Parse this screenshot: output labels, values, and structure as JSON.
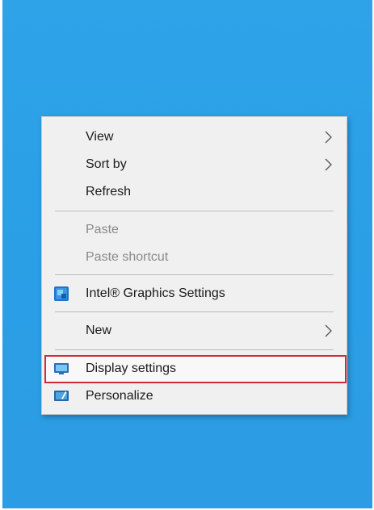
{
  "menu": {
    "items": [
      {
        "label": "View",
        "submenu": true,
        "enabled": true
      },
      {
        "label": "Sort by",
        "submenu": true,
        "enabled": true
      },
      {
        "label": "Refresh",
        "submenu": false,
        "enabled": true
      },
      {
        "label": "Paste",
        "submenu": false,
        "enabled": false
      },
      {
        "label": "Paste shortcut",
        "submenu": false,
        "enabled": false
      },
      {
        "label": "Intel® Graphics Settings",
        "submenu": false,
        "enabled": true,
        "icon": "intel-graphics-icon"
      },
      {
        "label": "New",
        "submenu": true,
        "enabled": true
      },
      {
        "label": "Display settings",
        "submenu": false,
        "enabled": true,
        "icon": "display-icon",
        "highlighted": true
      },
      {
        "label": "Personalize",
        "submenu": false,
        "enabled": true,
        "icon": "personalize-icon"
      }
    ]
  },
  "colors": {
    "desktop_background": "#2ea3e8",
    "menu_background": "#f0f0f0",
    "highlight_border": "#d12b3a"
  }
}
